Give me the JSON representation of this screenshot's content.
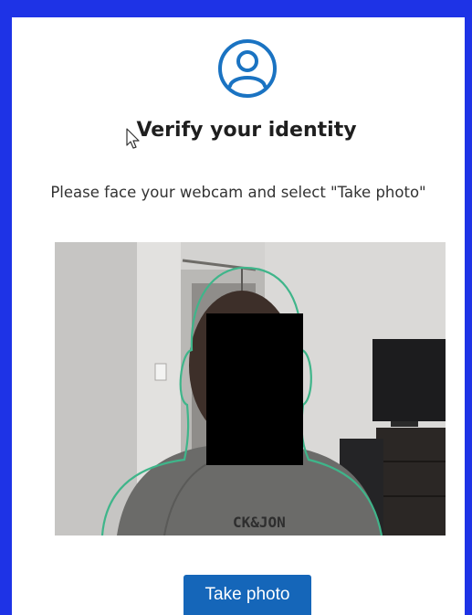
{
  "header": {
    "icon": "user-circle-icon",
    "title": "Verify your identity",
    "subtitle": "Please face your webcam and select \"Take photo\""
  },
  "webcam": {
    "guide_color": "#3fb58a",
    "shirt_print": "CK&JON"
  },
  "actions": {
    "take_photo_label": "Take photo"
  },
  "colors": {
    "frame": "#1e33e6",
    "accent": "#1a73c2",
    "button": "#1566b9"
  }
}
